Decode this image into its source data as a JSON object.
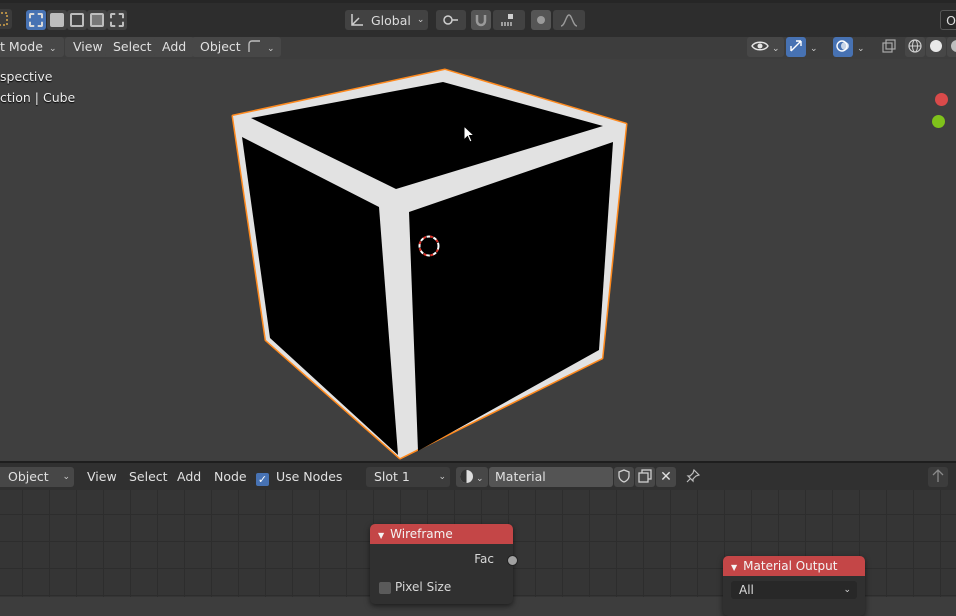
{
  "header": {
    "transform_orientation": "Global",
    "right_edge_label": "O"
  },
  "viewport_header": {
    "mode": "t Mode",
    "menus": [
      "View",
      "Select",
      "Add",
      "Object"
    ]
  },
  "viewport": {
    "view_name": "spective",
    "collection_label": "ction | Cube"
  },
  "node_editor_header": {
    "editor_type": "Object",
    "menus": [
      "View",
      "Select",
      "Add",
      "Node"
    ],
    "use_nodes_label": "Use Nodes",
    "use_nodes_checked": true,
    "slot": "Slot 1",
    "material_name": "Material"
  },
  "nodes": {
    "wireframe": {
      "title": "Wireframe",
      "output_fac": "Fac",
      "pixel_size_label": "Pixel Size"
    },
    "material_output": {
      "title": "Material Output",
      "target": "All"
    }
  },
  "colors": {
    "node_header": "#c44647",
    "selection_outline": "#ff8a1e",
    "axis_x": "#d94a4a",
    "axis_y": "#7fc21b",
    "active_blue": "#4772b3"
  }
}
